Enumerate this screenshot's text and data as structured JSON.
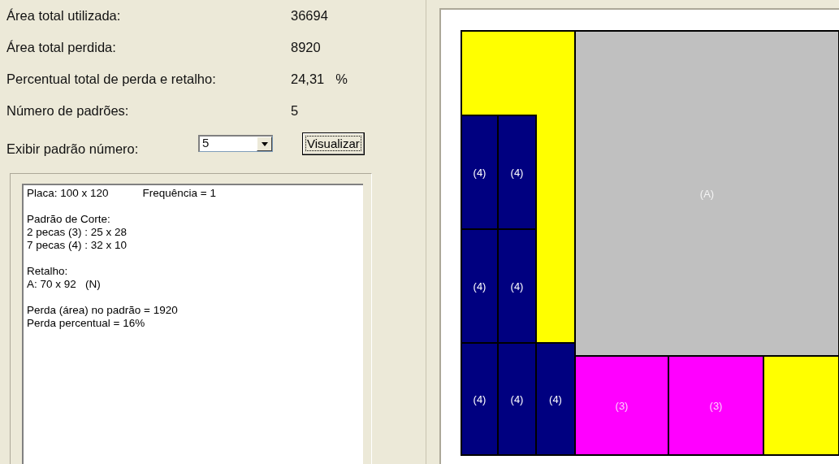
{
  "summary": [
    {
      "label": "Área total utilizada:",
      "value": "36694"
    },
    {
      "label": "Área total perdida:",
      "value": "8920"
    },
    {
      "label": "Percentual total de perda e retalho:",
      "value": "24,31",
      "unit": "%"
    },
    {
      "label": "Número de padrões:",
      "value": "5"
    }
  ],
  "pattern_select": {
    "label": "Exibir padrão número:",
    "value": "5"
  },
  "view_button": "Visualizar",
  "report": {
    "header": [
      "Placa: 100 x 120",
      "Frequência = 1"
    ],
    "blocks": [
      [
        "Padrão de Corte:",
        "2 pecas (3) : 25 x 28",
        "7 pecas (4) : 32 x 10"
      ],
      [
        "Retalho:",
        "A: 70 x 92   (N)"
      ],
      [
        "Perda (área) no padrão = 1920",
        "Perda percentual = 16%"
      ]
    ]
  },
  "diagram": {
    "pieces": [
      {
        "kind": "waste",
        "color": "#ffff00"
      },
      {
        "kind": "remnant",
        "label": "(A)",
        "color": "#c0c0c0"
      },
      {
        "kind": "piece",
        "label": "(4)",
        "color": "#000080"
      },
      {
        "kind": "piece",
        "label": "(4)",
        "color": "#000080"
      },
      {
        "kind": "piece",
        "label": "(4)",
        "color": "#000080"
      },
      {
        "kind": "piece",
        "label": "(4)",
        "color": "#000080"
      },
      {
        "kind": "piece",
        "label": "(4)",
        "color": "#000080"
      },
      {
        "kind": "piece",
        "label": "(4)",
        "color": "#000080"
      },
      {
        "kind": "piece",
        "label": "(4)",
        "color": "#000080"
      },
      {
        "kind": "piece",
        "label": "(3)",
        "color": "#ff00ff"
      },
      {
        "kind": "piece",
        "label": "(3)",
        "color": "#ff00ff"
      },
      {
        "kind": "waste",
        "color": "#ffff00"
      }
    ]
  }
}
